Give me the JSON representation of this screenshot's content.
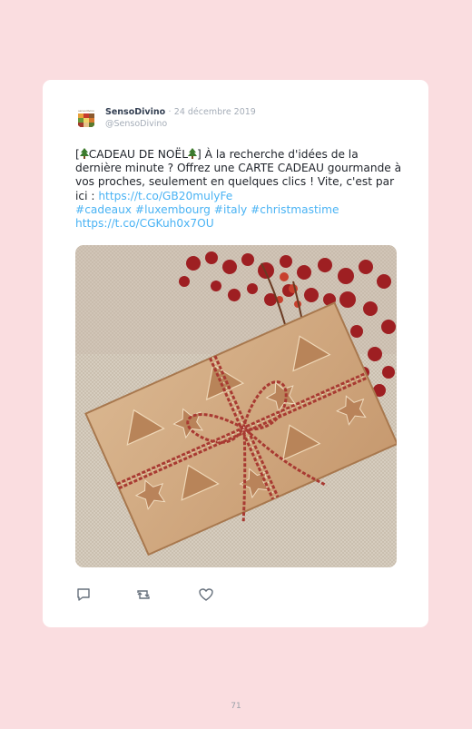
{
  "tweet": {
    "author_name": "SensoDivino",
    "separator": "·",
    "date": "24 décembre 2019",
    "handle": "@SensoDivino",
    "text_parts": {
      "p1": "[",
      "p2": "CADEAU DE NOËL",
      "p3": "] À la recherche d'idées de la dernière minute ? Offrez une CARTE CADEAU gourmande à vos proches, seulement en quelques clics ! Vite, c'est par ici : ",
      "link1": "https://t.co/GB20mulyFe",
      "hashtag1": "#cadeaux",
      "hashtag2": "#luxembourg",
      "hashtag3": "#italy",
      "hashtag4": "#christmastime",
      "link2": "https://t.co/CGKuh0x7OU"
    },
    "emoji_icon": "christmas-tree-icon",
    "image_subject": "gift-photo",
    "actions": [
      "reply-icon",
      "retweet-icon",
      "like-icon"
    ]
  },
  "page": {
    "number": "71"
  },
  "colors": {
    "background": "#fadde0",
    "link": "#4ab3f4",
    "card": "#ffffff"
  }
}
